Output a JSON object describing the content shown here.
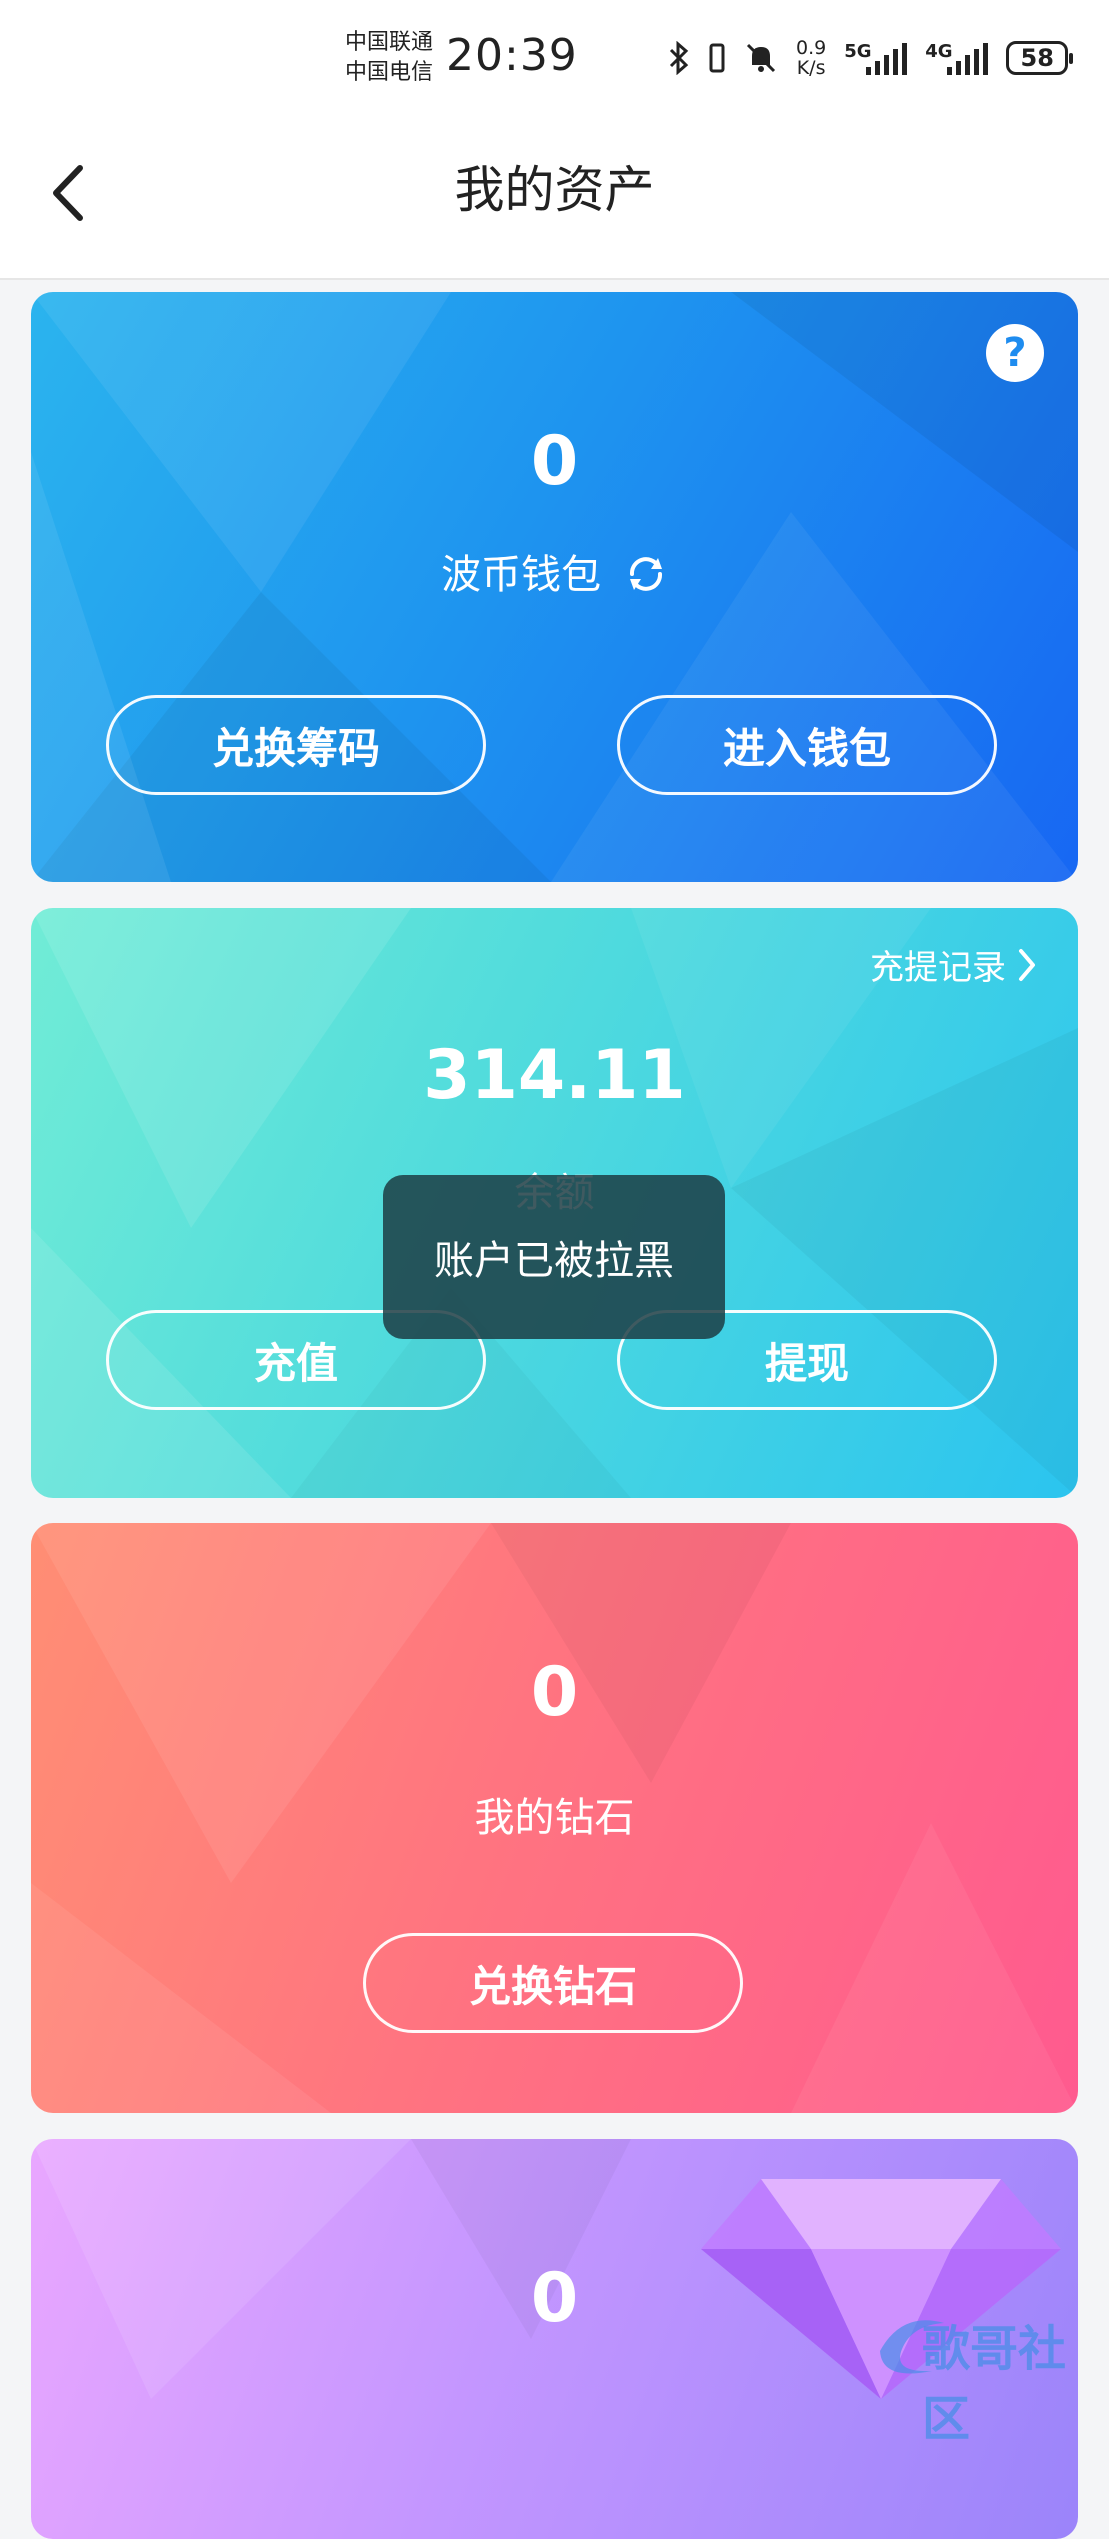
{
  "status_bar": {
    "carrier_1": "中国联通",
    "carrier_2": "中国电信",
    "time": "20:39",
    "speed_value": "0.9",
    "speed_unit": "K/s",
    "network_1": "5G",
    "network_2": "4G",
    "battery": "58",
    "icons": [
      "bluetooth-icon",
      "vibrate-icon",
      "mute-icon",
      "signal-5g-icon",
      "signal-4g-icon",
      "battery-icon"
    ]
  },
  "header": {
    "title": "我的资产",
    "back_icon": "chevron-left-icon"
  },
  "cards": {
    "wallet": {
      "amount": "0",
      "label": "波币钱包",
      "refresh_icon": "refresh-icon",
      "help_text": "?",
      "buttons": [
        "兑换筹码",
        "进入钱包"
      ],
      "color": "#1e8cef"
    },
    "balance": {
      "amount": "314.11",
      "label": "余额",
      "record_link": "充提记录",
      "buttons": [
        "充值",
        "提现"
      ],
      "color": "#2bc4ef"
    },
    "diamonds": {
      "amount": "0",
      "label": "我的钻石",
      "buttons": [
        "兑换钻石"
      ],
      "color": "#ff6a86"
    },
    "fourth": {
      "amount": "0",
      "decor_icon": "gem-icon",
      "color": "#b58cff"
    }
  },
  "toast": {
    "message": "账户已被拉黑"
  },
  "watermark": {
    "text": "歌哥社区"
  }
}
